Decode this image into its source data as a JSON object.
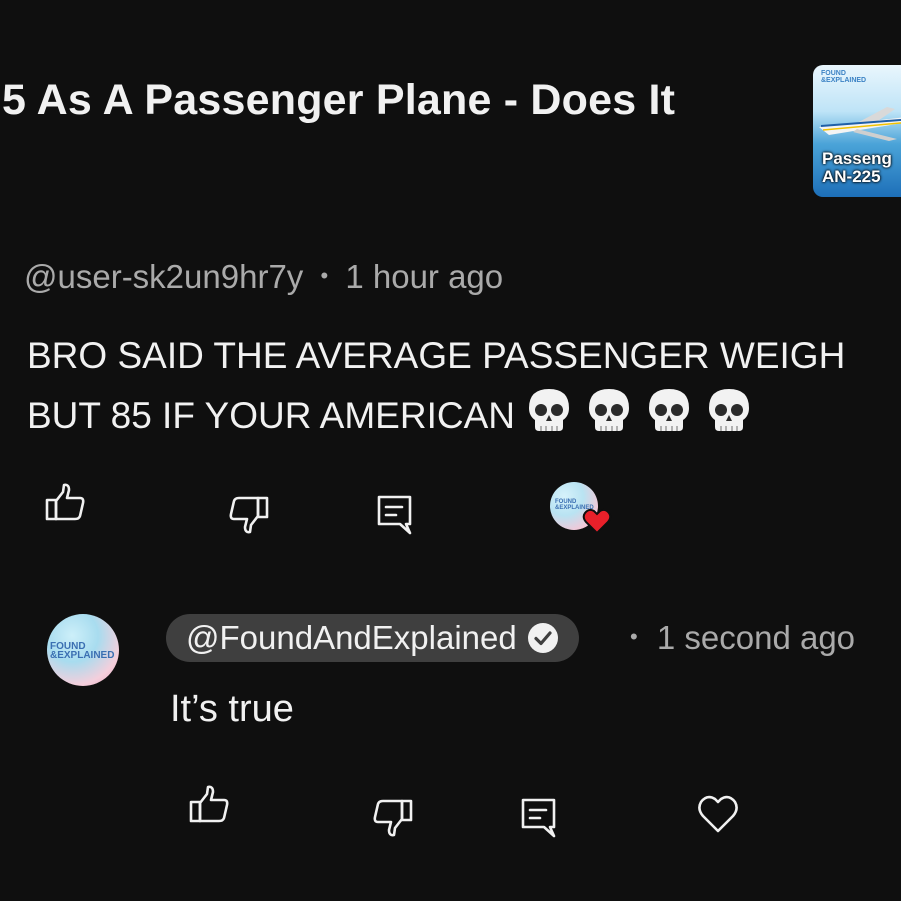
{
  "video": {
    "title": "5 As A Passenger Plane - Does It",
    "thumbnail": {
      "brand": "FOUND &EXPLAINED",
      "caption_line1": "Passeng",
      "caption_line2": "AN-225"
    }
  },
  "comment": {
    "author": "@user-sk2un9hr7y",
    "separator": "•",
    "time": "1 hour ago",
    "text_line1": "BRO SAID THE AVERAGE PASSENGER WEIGH",
    "text_line2": "BUT 85 IF YOUR AMERICAN",
    "emoji": [
      "skull",
      "skull",
      "skull",
      "skull"
    ],
    "creator_heart_brand": "FOUND &EXPLAINED"
  },
  "reply": {
    "avatar_brand": "FOUND &EXPLAINED",
    "author": "@FoundAndExplained",
    "separator": "•",
    "time": "1 second ago",
    "text": "It’s true"
  },
  "colors": {
    "background": "#0f0f0f",
    "text": "#f1f1f1",
    "muted": "#aaaaaa",
    "chip": "#3f3f3f",
    "heart": "#e8202a"
  },
  "icons": [
    "like-icon",
    "dislike-icon",
    "reply-icon",
    "heart-icon",
    "verified-icon",
    "skull-emoji"
  ]
}
